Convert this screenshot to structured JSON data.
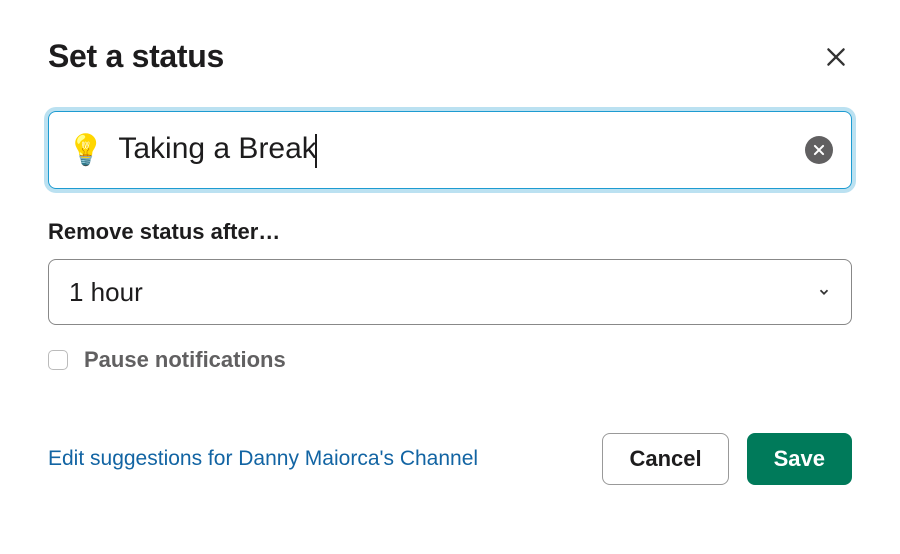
{
  "header": {
    "title": "Set a status"
  },
  "status": {
    "emoji": "💡",
    "text": "Taking a Break"
  },
  "remove": {
    "label": "Remove status after…",
    "selected": "1 hour"
  },
  "pause": {
    "label": "Pause notifications",
    "checked": false
  },
  "footer": {
    "edit_link": "Edit suggestions for Danny Maiorca's Channel",
    "cancel": "Cancel",
    "save": "Save"
  }
}
